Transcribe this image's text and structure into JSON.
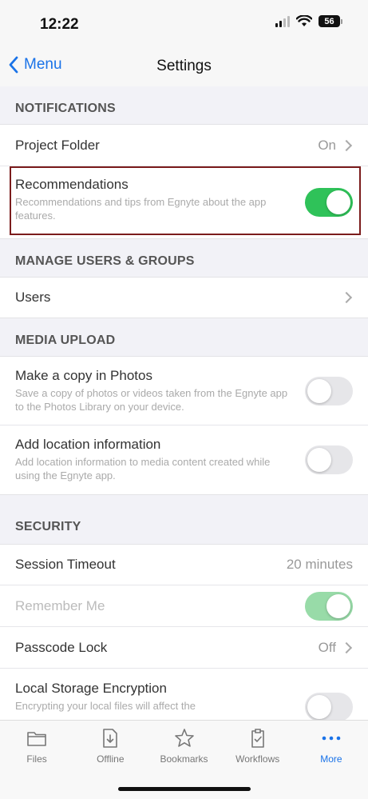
{
  "status": {
    "time": "12:22",
    "battery": "56"
  },
  "nav": {
    "back_label": "Menu",
    "title": "Settings"
  },
  "sections": {
    "notifications": {
      "header": "NOTIFICATIONS",
      "project_folder": {
        "title": "Project Folder",
        "value": "On"
      },
      "recommendations": {
        "title": "Recommendations",
        "subtitle": "Recommendations and tips from Egnyte about the app features.",
        "enabled": true
      }
    },
    "manage_users": {
      "header": "MANAGE USERS & GROUPS",
      "users": {
        "title": "Users"
      }
    },
    "media_upload": {
      "header": "MEDIA UPLOAD",
      "copy_photos": {
        "title": "Make a copy in Photos",
        "subtitle": "Save a copy of photos or videos taken from the Egnyte app to the Photos Library on your device.",
        "enabled": false
      },
      "location_info": {
        "title": "Add location information",
        "subtitle": "Add location information to media content created while using the Egnyte app.",
        "enabled": false
      }
    },
    "security": {
      "header": "SECURITY",
      "session_timeout": {
        "title": "Session Timeout",
        "value": "20 minutes"
      },
      "remember_me": {
        "title": "Remember Me",
        "enabled": true,
        "disabled": true
      },
      "passcode_lock": {
        "title": "Passcode Lock",
        "value": "Off"
      },
      "local_storage": {
        "title": "Local Storage Encryption",
        "subtitle": "Encrypting your local files will affect the",
        "enabled": false
      }
    }
  },
  "tabs": [
    {
      "label": "Files",
      "icon": "folder-icon"
    },
    {
      "label": "Offline",
      "icon": "offline-download-icon"
    },
    {
      "label": "Bookmarks",
      "icon": "star-icon"
    },
    {
      "label": "Workflows",
      "icon": "clipboard-check-icon"
    },
    {
      "label": "More",
      "icon": "more-dots-icon",
      "active": true
    }
  ],
  "colors": {
    "accent": "#1a73e8",
    "toggle_on": "#2fc259",
    "highlight": "#7b1c1c"
  }
}
